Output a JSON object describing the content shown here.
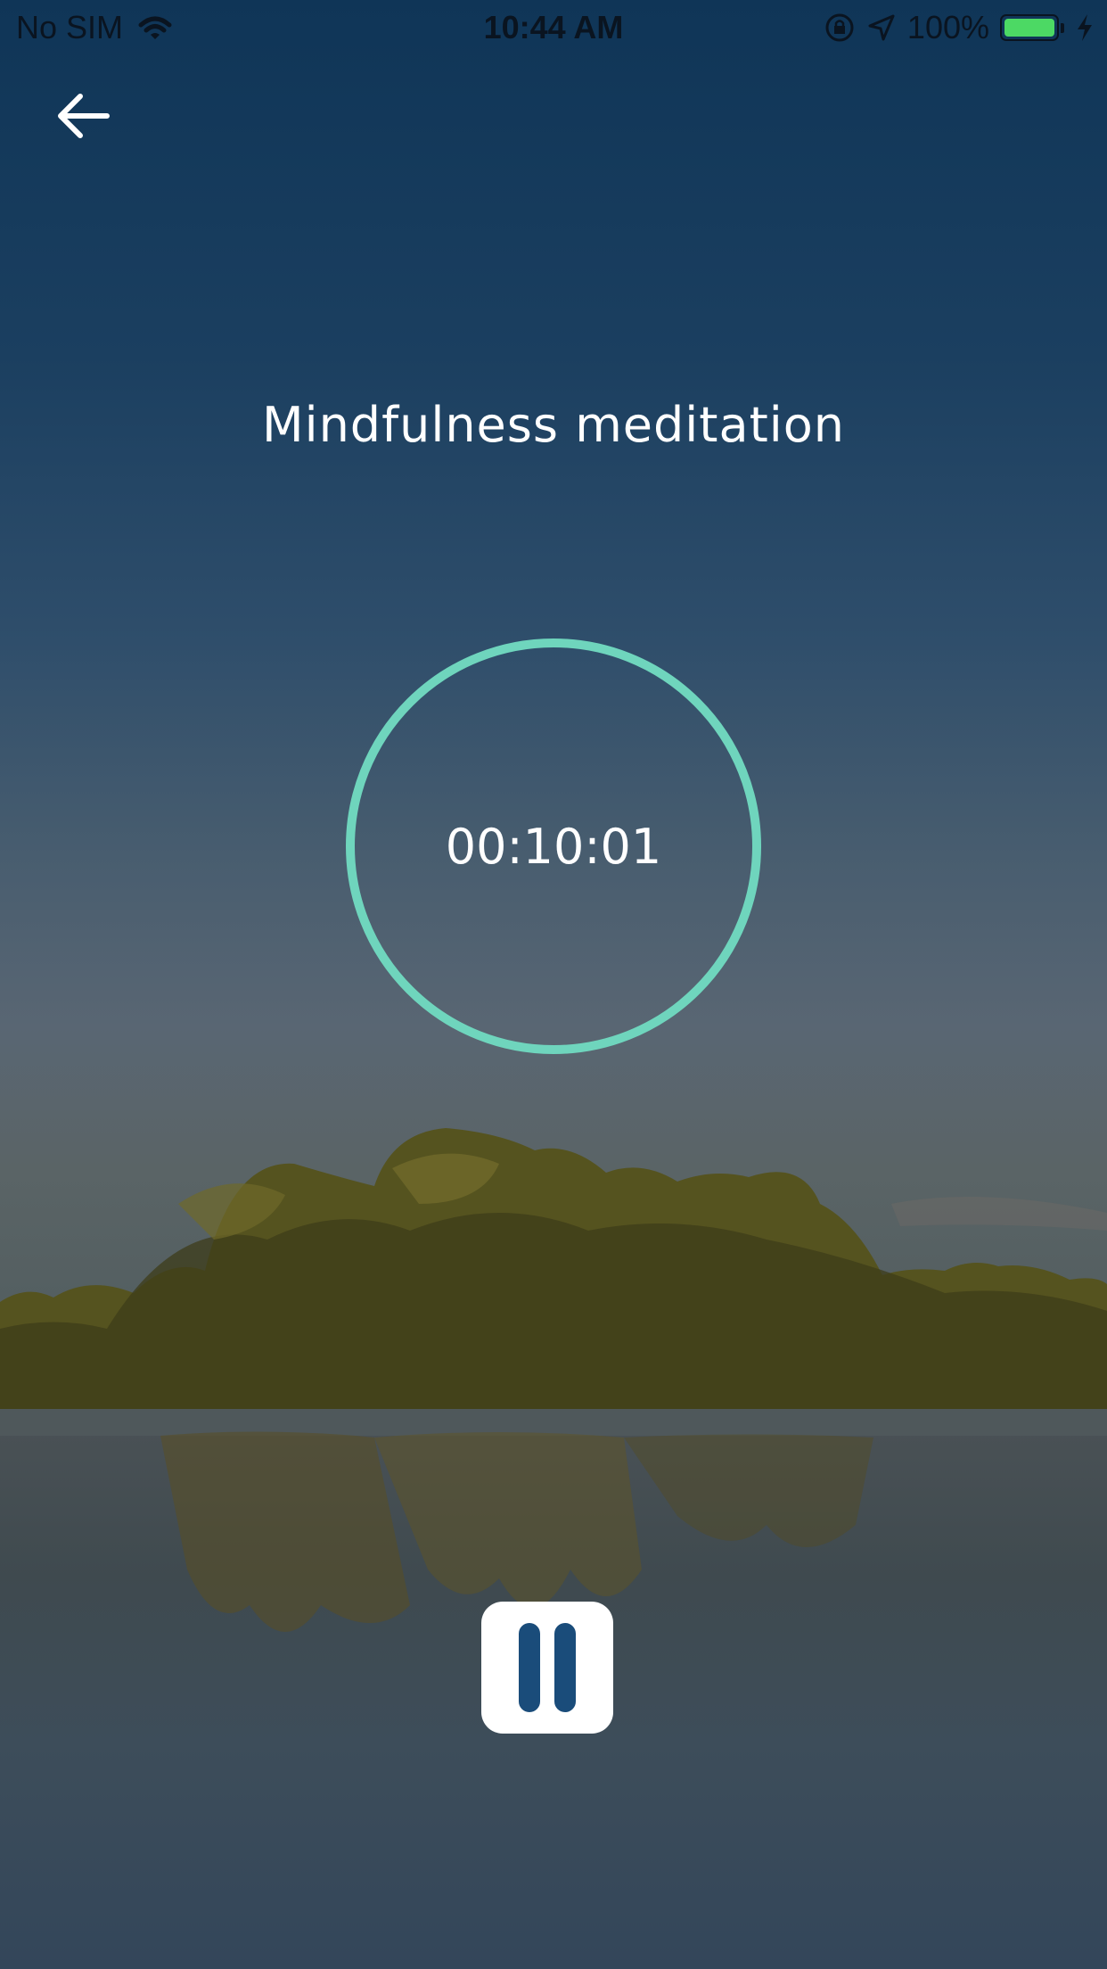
{
  "status_bar": {
    "carrier": "No SIM",
    "time": "10:44 AM",
    "battery": "100%"
  },
  "header": {
    "back_icon": "arrow-left-icon"
  },
  "session": {
    "title": "Mindfulness meditation",
    "timer": "00:10:01"
  },
  "controls": {
    "pause_icon": "pause-icon"
  },
  "colors": {
    "accent": "#6fd5bd",
    "pause_bars": "#1a4c7a",
    "battery": "#4cd964"
  }
}
